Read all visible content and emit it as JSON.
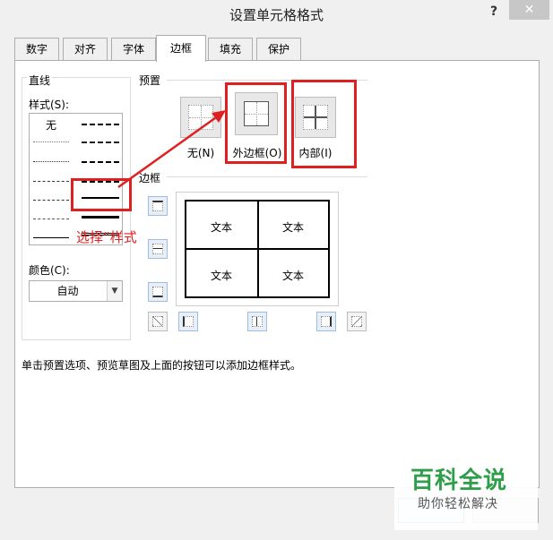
{
  "window": {
    "title": "设置单元格格式",
    "help": "?",
    "close": "✕"
  },
  "tabs": [
    "数字",
    "对齐",
    "字体",
    "边框",
    "填充",
    "保护"
  ],
  "line": {
    "group_title": "直线",
    "style_label": "样式(S):",
    "none_label": "无",
    "color_label": "颜色(C):",
    "color_value": "自动"
  },
  "presets": {
    "group_title": "预置",
    "items": [
      {
        "label": "无(N)",
        "icon": "no-border-icon"
      },
      {
        "label": "外边框(O)",
        "icon": "outline-border-icon"
      },
      {
        "label": "内部(I)",
        "icon": "inside-border-icon"
      }
    ]
  },
  "border": {
    "group_title": "边框",
    "cells": [
      "文本",
      "文本",
      "文本",
      "文本"
    ]
  },
  "hint": "单击预置选项、预览草图及上面的按钮可以添加边框样式。",
  "annotation": "选择“样式",
  "watermark": {
    "title": "百科全说",
    "subtitle": "助你轻松解决"
  },
  "colors": {
    "highlight": "#e02020",
    "watermark": "#2e9e4a",
    "selected_button": "#e6eef8"
  }
}
